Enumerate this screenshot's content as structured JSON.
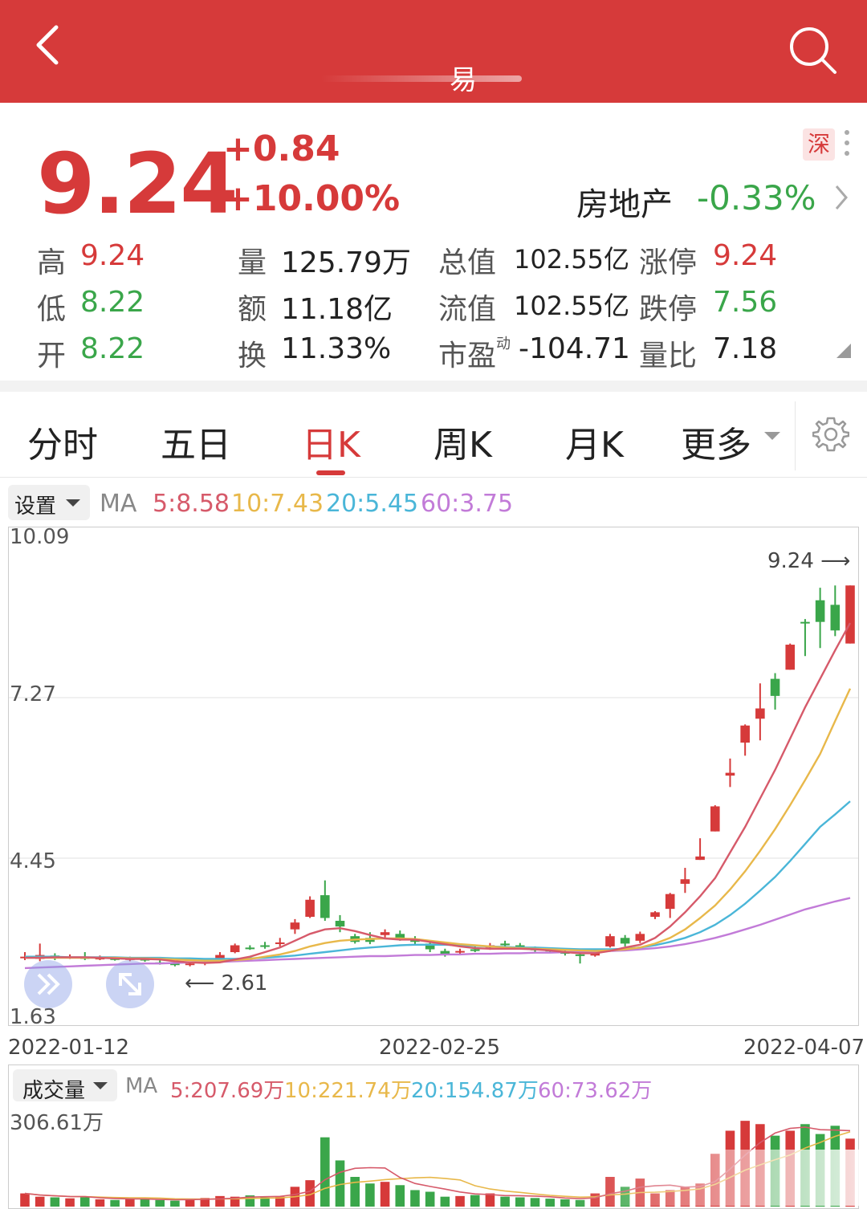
{
  "header": {
    "title": "易",
    "back_icon": "chevron-left-icon",
    "search_icon": "search-icon"
  },
  "quote": {
    "price": "9.24",
    "change": "+0.84",
    "change_pct": "+10.00%",
    "exchange": "深",
    "sector": "房地产",
    "sector_change": "-0.33%",
    "stats": {
      "high_label": "高",
      "high": "9.24",
      "low_label": "低",
      "low": "8.22",
      "open_label": "开",
      "open": "8.22",
      "volume_label": "量",
      "volume": "125.79万",
      "amount_label": "额",
      "amount": "11.18亿",
      "turnover_label": "换",
      "turnover": "11.33%",
      "mcap_label": "总值",
      "mcap": "102.55亿",
      "float_label": "流值",
      "float": "102.55亿",
      "pe_label": "市盈",
      "pe_sup": "动",
      "pe": "-104.71",
      "limit_up_label": "涨停",
      "limit_up": "9.24",
      "limit_down_label": "跌停",
      "limit_down": "7.56",
      "vol_ratio_label": "量比",
      "vol_ratio": "7.18"
    }
  },
  "tabs": [
    {
      "label": "分时"
    },
    {
      "label": "五日"
    },
    {
      "label": "日K"
    },
    {
      "label": "周K"
    },
    {
      "label": "月K"
    },
    {
      "label": "更多"
    }
  ],
  "active_tab": "日K",
  "kline": {
    "settings_label": "设置",
    "ma_label": "MA",
    "ma5": "5:8.58",
    "ma10": "10:7.43",
    "ma20": "20:5.45",
    "ma60": "60:3.75",
    "y_ticks": [
      "10.09",
      "7.27",
      "4.45",
      "1.63"
    ],
    "high_marker": "9.24",
    "low_marker": "2.61",
    "dates": [
      "2022-01-12",
      "2022-02-25",
      "2022-04-07"
    ]
  },
  "volume": {
    "selector_label": "成交量",
    "ma_label": "MA",
    "ma5": "5:207.69万",
    "ma10": "10:221.74万",
    "ma20": "20:154.87万",
    "ma60": "60:73.62万",
    "max_label": "306.61万"
  },
  "colors": {
    "brand_red": "#d63a3a",
    "down_green": "#3aa64a",
    "ma5": "#d65a6a",
    "ma10": "#e8b84a",
    "ma20": "#4ab6d8",
    "ma60": "#c27bd8"
  },
  "chart_data": {
    "type": "candlestick",
    "y_range": [
      1.63,
      10.09
    ],
    "x_range_dates": [
      "2022-01-12",
      "2022-04-07"
    ],
    "candles": [
      {
        "o": 2.7,
        "c": 2.72,
        "h": 2.8,
        "l": 2.66
      },
      {
        "o": 2.68,
        "c": 2.75,
        "h": 2.95,
        "l": 2.64
      },
      {
        "o": 2.74,
        "c": 2.7,
        "h": 2.78,
        "l": 2.66
      },
      {
        "o": 2.7,
        "c": 2.72,
        "h": 2.76,
        "l": 2.68
      },
      {
        "o": 2.71,
        "c": 2.69,
        "h": 2.8,
        "l": 2.66
      },
      {
        "o": 2.68,
        "c": 2.7,
        "h": 2.74,
        "l": 2.66
      },
      {
        "o": 2.69,
        "c": 2.68,
        "h": 2.72,
        "l": 2.65
      },
      {
        "o": 2.67,
        "c": 2.69,
        "h": 2.72,
        "l": 2.64
      },
      {
        "o": 2.68,
        "c": 2.66,
        "h": 2.71,
        "l": 2.63
      },
      {
        "o": 2.62,
        "c": 2.6,
        "h": 2.66,
        "l": 2.58
      },
      {
        "o": 2.6,
        "c": 2.58,
        "h": 2.64,
        "l": 2.55
      },
      {
        "o": 2.58,
        "c": 2.6,
        "h": 2.63,
        "l": 2.55
      },
      {
        "o": 2.6,
        "c": 2.63,
        "h": 2.66,
        "l": 2.57
      },
      {
        "o": 2.64,
        "c": 2.75,
        "h": 2.8,
        "l": 2.62
      },
      {
        "o": 2.8,
        "c": 2.92,
        "h": 2.95,
        "l": 2.78
      },
      {
        "o": 2.88,
        "c": 2.86,
        "h": 2.92,
        "l": 2.84
      },
      {
        "o": 2.92,
        "c": 2.9,
        "h": 2.98,
        "l": 2.86
      },
      {
        "o": 2.95,
        "c": 2.97,
        "h": 3.05,
        "l": 2.9
      },
      {
        "o": 3.2,
        "c": 3.32,
        "h": 3.38,
        "l": 3.12
      },
      {
        "o": 3.42,
        "c": 3.72,
        "h": 3.78,
        "l": 3.4
      },
      {
        "o": 3.8,
        "c": 3.4,
        "h": 4.06,
        "l": 3.35
      },
      {
        "o": 3.35,
        "c": 3.25,
        "h": 3.45,
        "l": 3.15
      },
      {
        "o": 3.08,
        "c": 2.98,
        "h": 3.12,
        "l": 2.95
      },
      {
        "o": 3.05,
        "c": 2.98,
        "h": 3.15,
        "l": 2.94
      },
      {
        "o": 3.1,
        "c": 3.15,
        "h": 3.2,
        "l": 3.05
      },
      {
        "o": 3.12,
        "c": 3.05,
        "h": 3.18,
        "l": 3.0
      },
      {
        "o": 3.04,
        "c": 2.98,
        "h": 3.08,
        "l": 2.94
      },
      {
        "o": 2.95,
        "c": 2.85,
        "h": 2.98,
        "l": 2.8
      },
      {
        "o": 2.82,
        "c": 2.76,
        "h": 2.86,
        "l": 2.72
      },
      {
        "o": 2.8,
        "c": 2.82,
        "h": 2.86,
        "l": 2.76
      },
      {
        "o": 2.85,
        "c": 2.82,
        "h": 2.9,
        "l": 2.8
      },
      {
        "o": 2.88,
        "c": 2.92,
        "h": 2.96,
        "l": 2.84
      },
      {
        "o": 2.95,
        "c": 2.92,
        "h": 3.0,
        "l": 2.88
      },
      {
        "o": 2.92,
        "c": 2.88,
        "h": 2.96,
        "l": 2.85
      },
      {
        "o": 2.86,
        "c": 2.84,
        "h": 2.9,
        "l": 2.8
      },
      {
        "o": 2.84,
        "c": 2.82,
        "h": 2.88,
        "l": 2.78
      },
      {
        "o": 2.8,
        "c": 2.78,
        "h": 2.86,
        "l": 2.74
      },
      {
        "o": 2.76,
        "c": 2.74,
        "h": 2.82,
        "l": 2.6
      },
      {
        "o": 2.74,
        "c": 2.82,
        "h": 2.86,
        "l": 2.72
      },
      {
        "o": 2.9,
        "c": 3.08,
        "h": 3.12,
        "l": 2.88
      },
      {
        "o": 3.05,
        "c": 2.95,
        "h": 3.1,
        "l": 2.9
      },
      {
        "o": 3.0,
        "c": 3.12,
        "h": 3.16,
        "l": 2.96
      },
      {
        "o": 3.42,
        "c": 3.5,
        "h": 3.52,
        "l": 3.38
      },
      {
        "o": 3.56,
        "c": 3.82,
        "h": 3.84,
        "l": 3.4
      },
      {
        "o": 4.0,
        "c": 4.08,
        "h": 4.28,
        "l": 3.84
      },
      {
        "o": 4.42,
        "c": 4.48,
        "h": 4.8,
        "l": 4.42
      },
      {
        "o": 4.92,
        "c": 5.36,
        "h": 5.38,
        "l": 4.92
      },
      {
        "o": 5.9,
        "c": 5.95,
        "h": 6.2,
        "l": 5.7
      },
      {
        "o": 6.48,
        "c": 6.78,
        "h": 6.8,
        "l": 6.25
      },
      {
        "o": 6.9,
        "c": 7.08,
        "h": 7.52,
        "l": 6.52
      },
      {
        "o": 7.6,
        "c": 7.3,
        "h": 7.7,
        "l": 7.06
      },
      {
        "o": 7.76,
        "c": 8.2,
        "h": 8.22,
        "l": 7.76
      },
      {
        "o": 8.6,
        "c": 8.58,
        "h": 8.65,
        "l": 8.0
      },
      {
        "o": 8.98,
        "c": 8.6,
        "h": 9.2,
        "l": 8.14
      },
      {
        "o": 8.9,
        "c": 8.45,
        "h": 9.24,
        "l": 8.35
      },
      {
        "o": 8.22,
        "c": 9.24,
        "h": 9.24,
        "l": 8.22
      }
    ],
    "ma5_line": [
      2.7,
      2.7,
      2.71,
      2.71,
      2.71,
      2.7,
      2.69,
      2.68,
      2.68,
      2.67,
      2.64,
      2.62,
      2.61,
      2.62,
      2.67,
      2.72,
      2.8,
      2.88,
      3.0,
      3.12,
      3.2,
      3.22,
      3.17,
      3.1,
      3.04,
      3.02,
      3.02,
      2.98,
      2.94,
      2.9,
      2.87,
      2.86,
      2.86,
      2.86,
      2.85,
      2.83,
      2.8,
      2.78,
      2.78,
      2.82,
      2.88,
      2.93,
      3.05,
      3.25,
      3.5,
      3.78,
      4.1,
      4.55,
      5.0,
      5.5,
      6.0,
      6.55,
      7.1,
      7.6,
      8.1,
      8.58
    ],
    "ma10_line": [
      2.7,
      2.7,
      2.7,
      2.7,
      2.7,
      2.7,
      2.7,
      2.69,
      2.69,
      2.68,
      2.67,
      2.66,
      2.65,
      2.65,
      2.66,
      2.68,
      2.72,
      2.76,
      2.82,
      2.9,
      2.96,
      3.0,
      3.02,
      3.03,
      3.04,
      3.04,
      3.03,
      3.0,
      2.97,
      2.94,
      2.92,
      2.9,
      2.88,
      2.87,
      2.86,
      2.85,
      2.84,
      2.83,
      2.82,
      2.83,
      2.85,
      2.88,
      2.95,
      3.05,
      3.2,
      3.4,
      3.62,
      3.9,
      4.22,
      4.58,
      4.96,
      5.38,
      5.82,
      6.28,
      6.86,
      7.43
    ],
    "ma20_line": [
      2.72,
      2.72,
      2.72,
      2.71,
      2.71,
      2.71,
      2.71,
      2.7,
      2.7,
      2.7,
      2.69,
      2.69,
      2.68,
      2.68,
      2.68,
      2.69,
      2.7,
      2.72,
      2.74,
      2.77,
      2.8,
      2.83,
      2.86,
      2.88,
      2.9,
      2.92,
      2.93,
      2.93,
      2.93,
      2.92,
      2.91,
      2.9,
      2.89,
      2.88,
      2.88,
      2.87,
      2.86,
      2.85,
      2.85,
      2.85,
      2.86,
      2.88,
      2.92,
      2.98,
      3.05,
      3.15,
      3.28,
      3.45,
      3.65,
      3.88,
      4.12,
      4.4,
      4.7,
      5.0,
      5.22,
      5.45
    ],
    "ma60_line": [
      2.52,
      2.53,
      2.54,
      2.55,
      2.56,
      2.57,
      2.58,
      2.59,
      2.6,
      2.6,
      2.61,
      2.62,
      2.62,
      2.63,
      2.64,
      2.65,
      2.66,
      2.67,
      2.68,
      2.69,
      2.7,
      2.71,
      2.72,
      2.73,
      2.73,
      2.74,
      2.75,
      2.75,
      2.76,
      2.76,
      2.77,
      2.77,
      2.78,
      2.78,
      2.79,
      2.79,
      2.8,
      2.8,
      2.81,
      2.82,
      2.83,
      2.85,
      2.87,
      2.9,
      2.94,
      2.99,
      3.05,
      3.12,
      3.2,
      3.28,
      3.37,
      3.46,
      3.55,
      3.62,
      3.69,
      3.75
    ],
    "volumes": [
      40,
      30,
      28,
      25,
      28,
      22,
      20,
      22,
      24,
      20,
      18,
      22,
      26,
      32,
      30,
      34,
      28,
      30,
      60,
      80,
      210,
      140,
      90,
      70,
      75,
      65,
      50,
      45,
      30,
      32,
      35,
      40,
      30,
      28,
      26,
      24,
      22,
      20,
      40,
      90,
      60,
      85,
      40,
      50,
      60,
      70,
      160,
      230,
      260,
      250,
      215,
      230,
      250,
      220,
      245,
      206
    ],
    "vol_max": 306.61
  }
}
